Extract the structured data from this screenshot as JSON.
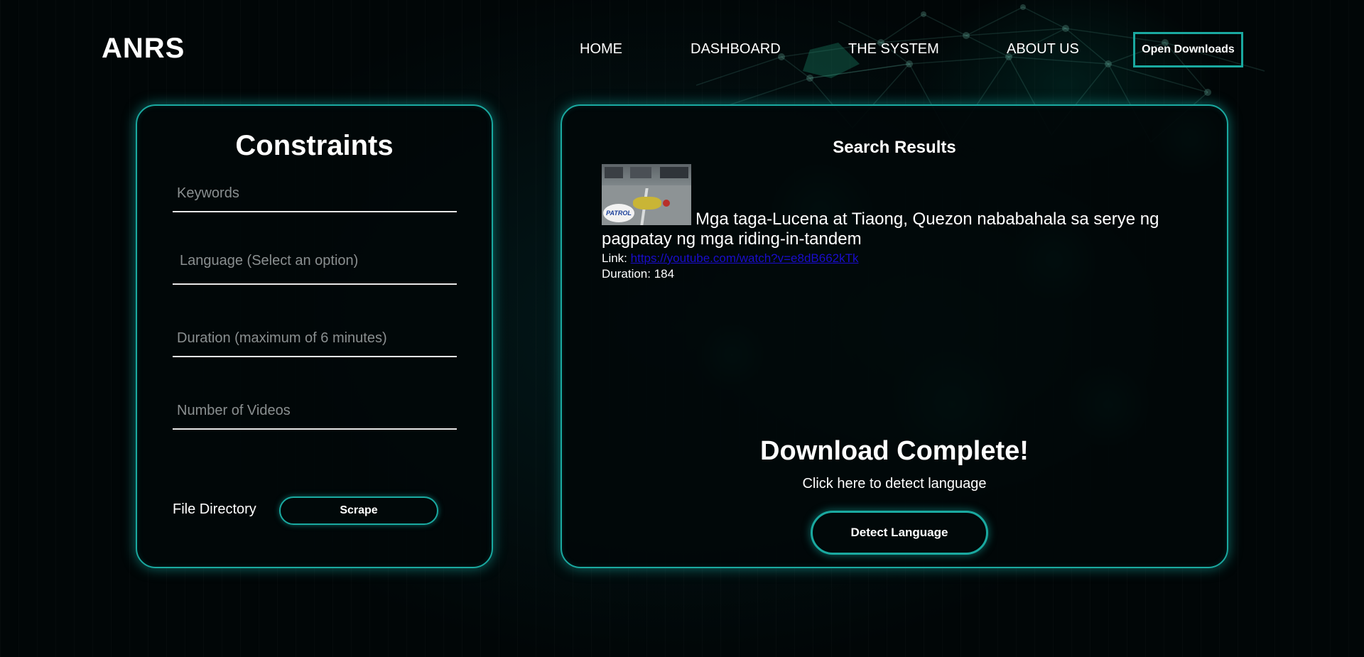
{
  "header": {
    "logo": "ANRS",
    "nav": [
      "HOME",
      "DASHBOARD",
      "THE SYSTEM",
      "ABOUT US"
    ],
    "open_downloads_label": "Open Downloads"
  },
  "constraints": {
    "title": "Constraints",
    "keywords_placeholder": "Keywords",
    "language_placeholder": "Language (Select an option)",
    "duration_placeholder": "Duration (maximum of 6 minutes)",
    "number_placeholder": "Number of Videos",
    "file_directory_label": "File Directory",
    "scrape_label": "Scrape"
  },
  "results": {
    "title": "Search Results",
    "item": {
      "thumbnail_logo": "PATROL",
      "title": "Mga taga-Lucena at Tiaong, Quezon nababahala sa serye ng pagpatay ng mga riding-in-tandem",
      "link_label": "Link:",
      "link_url": "https://youtube.com/watch?v=e8dB662kTk",
      "duration_label": "Duration:",
      "duration_value": "184"
    },
    "download_complete": "Download Complete!",
    "detect_hint": "Click here to detect language",
    "detect_button": "Detect Language"
  },
  "colors": {
    "accent": "#1aa9a0",
    "link": "#1a0dcc",
    "placeholder": "#8a8f90"
  }
}
